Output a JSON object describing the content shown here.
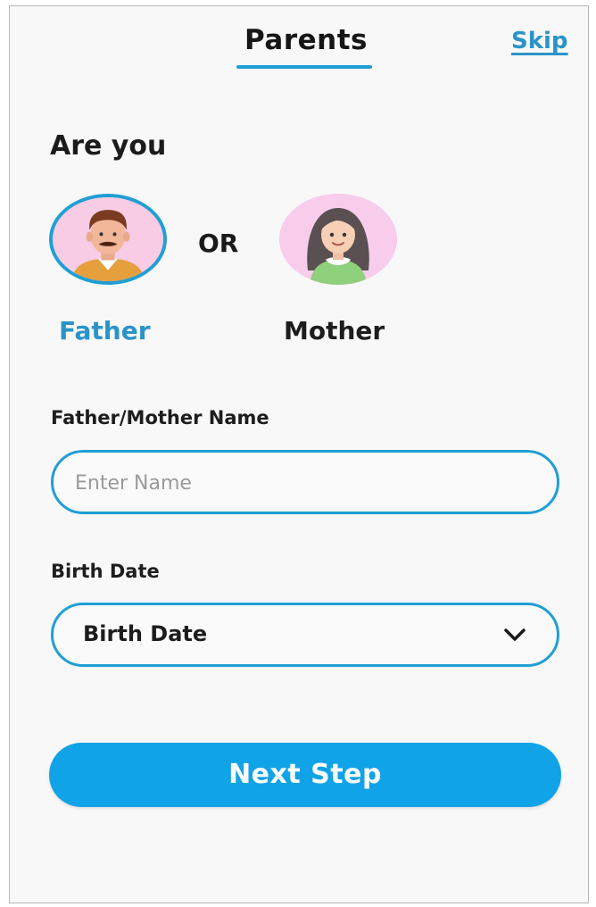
{
  "header": {
    "title": "Parents",
    "skip_label": "Skip"
  },
  "question": "Are you",
  "choices": {
    "father_label": "Father",
    "or_label": "OR",
    "mother_label": "Mother",
    "selected": "Father"
  },
  "form": {
    "name_label": "Father/Mother Name",
    "name_placeholder": "Enter Name",
    "name_value": "",
    "birth_label": "Birth Date",
    "birth_value": "Birth Date"
  },
  "next_button_label": "Next Step",
  "colors": {
    "accent": "#1f9fd4",
    "button": "#11a3e7",
    "background": "#f8f8f8"
  },
  "icons": {
    "father": "father-avatar-icon",
    "mother": "mother-avatar-icon",
    "dropdown": "chevron-down-icon"
  }
}
